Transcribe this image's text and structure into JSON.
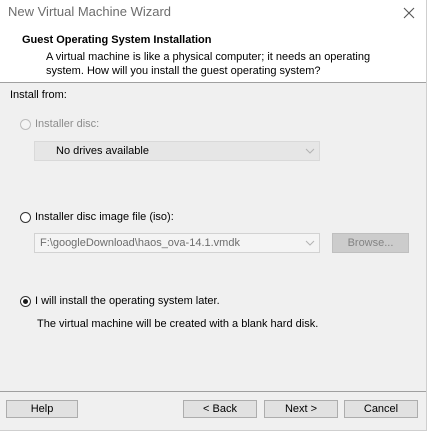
{
  "window": {
    "title": "New Virtual Machine Wizard"
  },
  "header": {
    "title": "Guest Operating System Installation",
    "description": "A virtual machine is like a physical computer; it needs an operating system. How will you install the guest operating system?"
  },
  "install_from": {
    "label": "Install from:",
    "installer_disc": {
      "label": "Installer disc:",
      "selected": false,
      "enabled": false,
      "drive_value": "No drives available"
    },
    "iso_option": {
      "label": "Installer disc image file (iso):",
      "selected": false,
      "path_value": "F:\\googleDownload\\haos_ova-14.1.vmdk",
      "browse_label": "Browse..."
    },
    "later_option": {
      "label": "I will install the operating system later.",
      "selected": true,
      "note": "The virtual machine will be created with a blank hard disk."
    }
  },
  "footer": {
    "help_label": "Help",
    "back_label": "< Back",
    "next_label": "Next >",
    "cancel_label": "Cancel"
  },
  "icons": {
    "close": "close-icon",
    "dropdown_arrow": "chevron-down-icon"
  }
}
